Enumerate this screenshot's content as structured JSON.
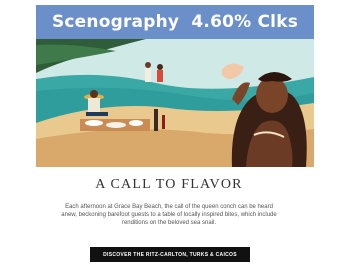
{
  "banner": {
    "label": "Scenography  4.60% Clks",
    "color": "#6a8fc9"
  },
  "illustration": {
    "description_icon": "beach-dinner-illustration-icon"
  },
  "headline": "A CALL TO FLAVOR",
  "body": "Each afternoon at Grace Bay Beach, the call of the queen conch can be heard anew, beckoning barefoot guests to a table of locally inspired bites, which include renditions on the beloved sea snail.",
  "cta": {
    "label": "DISCOVER THE RITZ-CARLTON, TURKS & CAICOS",
    "color": "#111111"
  }
}
